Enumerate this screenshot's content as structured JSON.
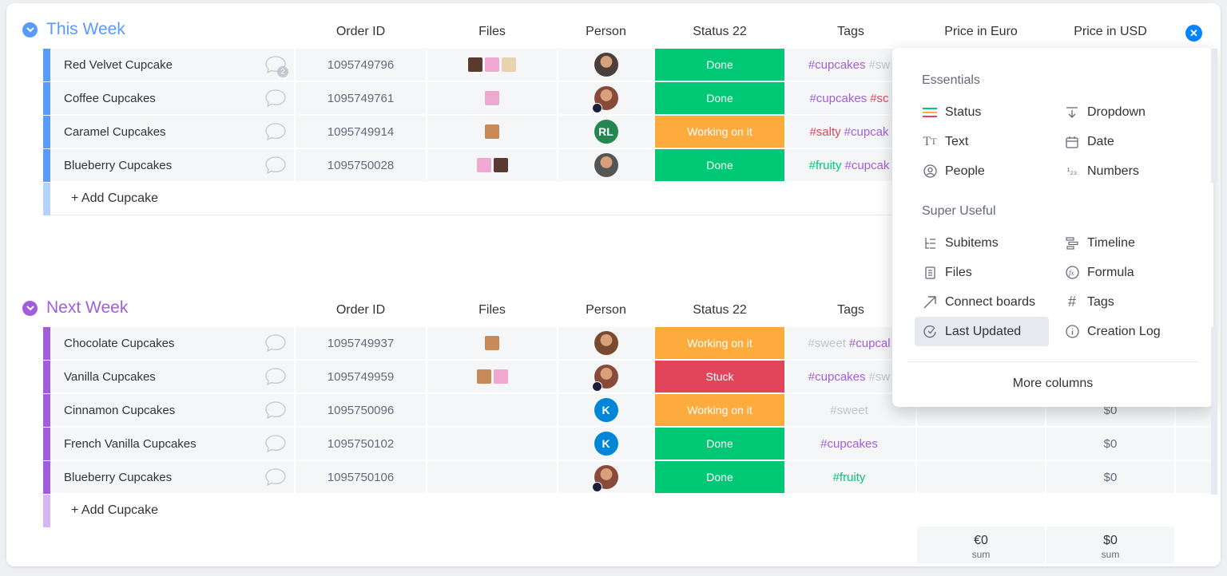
{
  "colors": {
    "status_done": "#00c875",
    "status_working": "#fdab3d",
    "status_stuck": "#e2445c",
    "group1": "#579bfc",
    "group2": "#a25ddc",
    "accent": "#0085ff"
  },
  "columns": {
    "order_id": "Order ID",
    "files": "Files",
    "person": "Person",
    "status": "Status 22",
    "tags": "Tags",
    "price_euro": "Price in Euro",
    "price_usd": "Price in USD"
  },
  "groups": [
    {
      "title": "This Week",
      "add_label": "+ Add Cupcake",
      "rows": [
        {
          "name": "Red Velvet Cupcake",
          "chat_count": "2",
          "order_id": "1095749796",
          "status": "Done",
          "tags": [
            {
              "t": "#cupcakes",
              "c": "#a25ddc"
            },
            {
              "t": "#sw",
              "c": "#c4c4c4"
            }
          ],
          "euro": "",
          "usd": ""
        },
        {
          "name": "Coffee Cupcakes",
          "chat_count": "",
          "order_id": "1095749761",
          "status": "Done",
          "tags": [
            {
              "t": "#cupcakes",
              "c": "#a25ddc"
            },
            {
              "t": "#sc",
              "c": "#e2445c"
            }
          ],
          "euro": "",
          "usd": ""
        },
        {
          "name": "Caramel Cupcakes",
          "chat_count": "",
          "order_id": "1095749914",
          "status": "Working on it",
          "tags": [
            {
              "t": "#salty",
              "c": "#e2445c"
            },
            {
              "t": "#cupcak",
              "c": "#a25ddc"
            }
          ],
          "euro": "",
          "usd": ""
        },
        {
          "name": "Blueberry Cupcakes",
          "chat_count": "",
          "order_id": "1095750028",
          "status": "Done",
          "tags": [
            {
              "t": "#fruity",
              "c": "#00c875"
            },
            {
              "t": "#cupcak",
              "c": "#a25ddc"
            }
          ],
          "euro": "",
          "usd": ""
        }
      ]
    },
    {
      "title": "Next Week",
      "add_label": "+ Add Cupcake",
      "rows": [
        {
          "name": "Chocolate Cupcakes",
          "chat_count": "",
          "order_id": "1095749937",
          "status": "Working on it",
          "tags": [
            {
              "t": "#sweet",
              "c": "#c4c4c4"
            },
            {
              "t": "#cupcal",
              "c": "#a25ddc"
            }
          ],
          "euro": "",
          "usd": ""
        },
        {
          "name": "Vanilla Cupcakes",
          "chat_count": "",
          "order_id": "1095749959",
          "status": "Stuck",
          "tags": [
            {
              "t": "#cupcakes",
              "c": "#a25ddc"
            },
            {
              "t": "#sw",
              "c": "#c4c4c4"
            }
          ],
          "euro": "",
          "usd": ""
        },
        {
          "name": "Cinnamon Cupcakes",
          "chat_count": "",
          "order_id": "1095750096",
          "status": "Working on it",
          "tags": [
            {
              "t": "#sweet",
              "c": "#c4c4c4"
            }
          ],
          "euro": "",
          "usd": "$0"
        },
        {
          "name": "French Vanilla Cupcakes",
          "chat_count": "",
          "order_id": "1095750102",
          "status": "Done",
          "tags": [
            {
              "t": "#cupcakes",
              "c": "#a25ddc"
            }
          ],
          "euro": "",
          "usd": "$0"
        },
        {
          "name": "Blueberry Cupcakes",
          "chat_count": "",
          "order_id": "1095750106",
          "status": "Done",
          "tags": [
            {
              "t": "#fruity",
              "c": "#00c875"
            }
          ],
          "euro": "",
          "usd": "$0"
        }
      ]
    }
  ],
  "avatars": {
    "rl": "RL",
    "k": "K"
  },
  "sums": {
    "euro": "€0",
    "usd": "$0",
    "label": "sum"
  },
  "menu": {
    "essentials_title": "Essentials",
    "useful_title": "Super Useful",
    "essentials": [
      "Status",
      "Dropdown",
      "Text",
      "Date",
      "People",
      "Numbers"
    ],
    "useful": [
      "Subitems",
      "Timeline",
      "Files",
      "Formula",
      "Connect boards",
      "Tags",
      "Last Updated",
      "Creation Log"
    ],
    "more": "More columns"
  }
}
